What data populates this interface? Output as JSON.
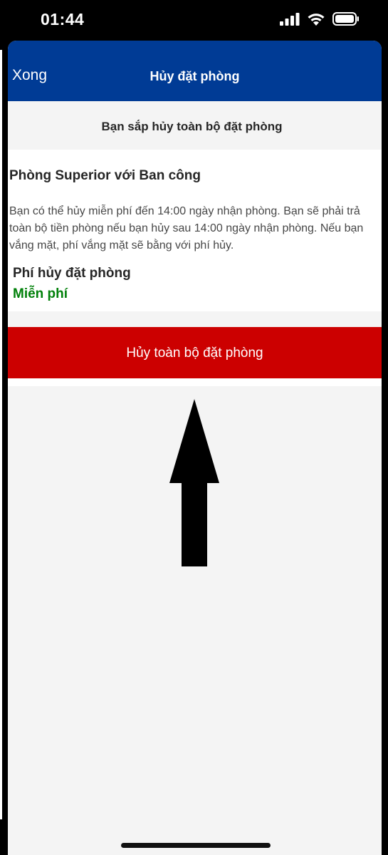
{
  "status_bar": {
    "time": "01:44",
    "icons": [
      "cellular-signal-icon",
      "wifi-icon",
      "battery-icon"
    ]
  },
  "nav": {
    "done_label": "Xong",
    "title": "Hủy đặt phòng",
    "background_color": "#003b95"
  },
  "notice": {
    "text": "Bạn sắp hủy toàn bộ đặt phòng"
  },
  "room": {
    "title": "Phòng Superior với Ban công",
    "policy_text": "Bạn có thể hủy miễn phí đến 14:00 ngày nhận phòng. Bạn sẽ phải trả toàn bộ tiền phòng nếu bạn hủy sau 14:00 ngày nhận phòng. Nếu bạn vắng mặt, phí vắng mặt sẽ bằng với phí hủy.",
    "fee_label": "Phí hủy đặt phòng",
    "fee_value": "Miễn phí",
    "fee_value_color": "#008009"
  },
  "actions": {
    "cancel_all_label": "Hủy toàn bộ đặt phòng",
    "cancel_button_color": "#cc0000"
  },
  "annotation": {
    "icon": "up-arrow-icon"
  }
}
